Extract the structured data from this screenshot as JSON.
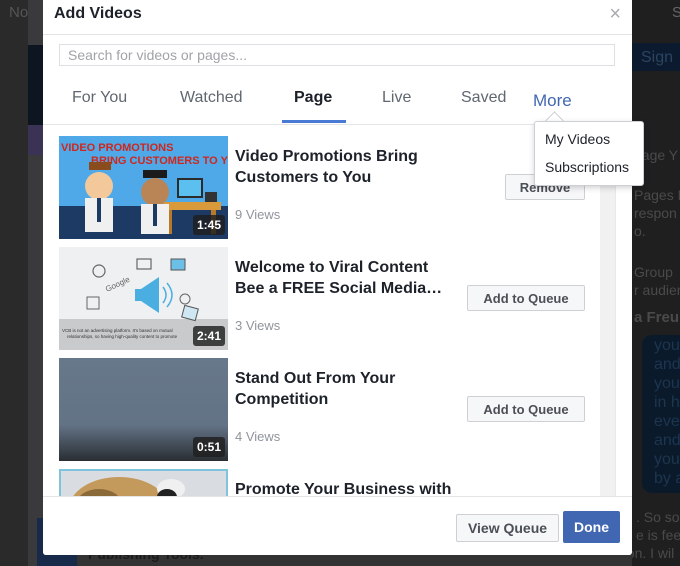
{
  "background": {
    "left_text": "No",
    "right_button": "Sign",
    "right_top_text": "S",
    "right_texts": [
      "nage Y",
      "Pages M",
      "respon",
      "o.",
      "Group",
      "r audien",
      "a Freun"
    ],
    "bubble_lines": [
      "you",
      "and",
      "you",
      "in hi",
      "ever",
      "and",
      "you",
      "by a"
    ],
    "bottom_right_texts": [
      ". So so",
      "e is feel",
      "soon. I wil"
    ],
    "bottom_left_text": "Publishing Tools."
  },
  "modal": {
    "title": "Add Videos",
    "close_icon": "×",
    "search": {
      "placeholder": "Search for videos or pages...",
      "value": ""
    },
    "tabs": [
      {
        "label": "For You",
        "active": false
      },
      {
        "label": "Watched",
        "active": false
      },
      {
        "label": "Page",
        "active": true
      },
      {
        "label": "Live",
        "active": false
      },
      {
        "label": "Saved",
        "active": false
      },
      {
        "label": "More",
        "active": false
      }
    ],
    "more_menu": {
      "items": [
        {
          "label": "My Videos"
        },
        {
          "label": "Subscriptions"
        }
      ]
    },
    "videos": [
      {
        "title": "Video Promotions Bring Customers to You",
        "views": "9 Views",
        "duration": "1:45",
        "action": "Remove",
        "thumb_caption": "VIDEO PROMOTIONS BRING CUSTOMERS TO YOU!"
      },
      {
        "title": "Welcome to Viral Content Bee a FREE Social Media…",
        "views": "3 Views",
        "duration": "2:41",
        "action": "Add to Queue",
        "thumb_caption": "VCB is not an advertising platform. It's based on mutual relationships, so having high-quality content to promote"
      },
      {
        "title": "Stand Out From Your Competition",
        "views": "4 Views",
        "duration": "0:51",
        "action": "Add to Queue"
      },
      {
        "title": "Promote Your Business with Video",
        "views": "",
        "duration": "",
        "action": ""
      }
    ],
    "footer": {
      "view_queue": "View Queue",
      "done": "Done"
    }
  },
  "colors": {
    "accent": "#4267b2",
    "tab_underline": "#4a7bd4"
  }
}
